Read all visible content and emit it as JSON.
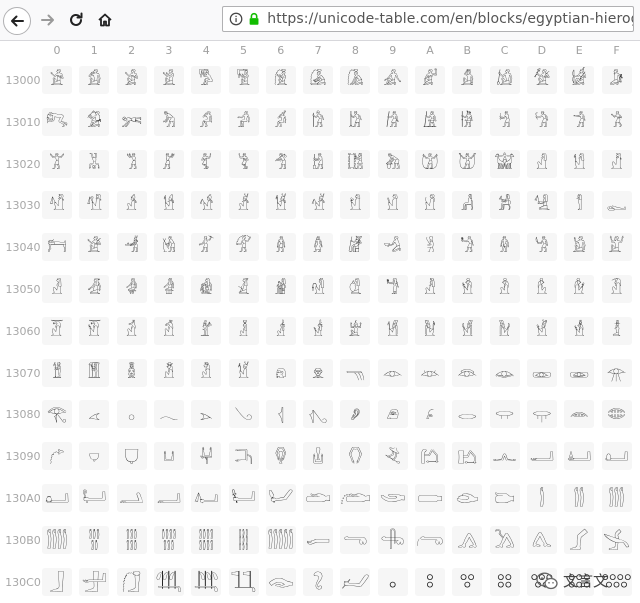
{
  "browser": {
    "url": "https://unicode-table.com/en/blocks/egyptian-hieroglyphs/",
    "icons": {
      "back": "arrow-left-icon",
      "forward": "arrow-right-icon",
      "reload": "reload-icon",
      "home": "home-icon",
      "info": "info-icon",
      "lock": "lock-icon"
    }
  },
  "table": {
    "columns": [
      "0",
      "1",
      "2",
      "3",
      "4",
      "5",
      "6",
      "7",
      "8",
      "9",
      "A",
      "B",
      "C",
      "D",
      "E",
      "F"
    ],
    "rows": [
      {
        "label": "13000",
        "chars": [
          "𓀀",
          "𓀁",
          "𓀂",
          "𓀃",
          "𓀄",
          "𓀅",
          "𓀆",
          "𓀇",
          "𓀈",
          "𓀉",
          "𓀊",
          "𓀋",
          "𓀌",
          "𓀍",
          "𓀎",
          "𓀏"
        ]
      },
      {
        "label": "13010",
        "chars": [
          "𓀐",
          "𓀑",
          "𓀒",
          "𓀓",
          "𓀔",
          "𓀕",
          "𓀖",
          "𓀗",
          "𓀘",
          "𓀙",
          "𓀚",
          "𓀛",
          "𓀜",
          "𓀝",
          "𓀞",
          "𓀟"
        ]
      },
      {
        "label": "13020",
        "chars": [
          "𓀠",
          "𓀡",
          "𓀢",
          "𓀣",
          "𓀤",
          "𓀥",
          "𓀦",
          "𓀧",
          "𓀨",
          "𓀩",
          "𓀪",
          "𓀫",
          "𓀬",
          "𓀭",
          "𓀮",
          "𓀯"
        ]
      },
      {
        "label": "13030",
        "chars": [
          "𓀰",
          "𓀱",
          "𓀲",
          "𓀳",
          "𓀴",
          "𓀵",
          "𓀶",
          "𓀷",
          "𓀸",
          "𓀹",
          "𓀺",
          "𓀻",
          "𓀼",
          "𓀽",
          "𓀾",
          "𓀿"
        ]
      },
      {
        "label": "13040",
        "chars": [
          "𓁀",
          "𓁁",
          "𓁂",
          "𓁃",
          "𓁄",
          "𓁅",
          "𓁆",
          "𓁇",
          "𓁈",
          "𓁉",
          "𓁊",
          "𓁋",
          "𓁌",
          "𓁍",
          "𓁎",
          "𓁏"
        ]
      },
      {
        "label": "13050",
        "chars": [
          "𓁐",
          "𓁑",
          "𓁒",
          "𓁓",
          "𓁔",
          "𓁕",
          "𓁖",
          "𓁗",
          "𓁘",
          "𓁙",
          "𓁚",
          "𓁛",
          "𓁜",
          "𓁝",
          "𓁞",
          "𓁟"
        ]
      },
      {
        "label": "13060",
        "chars": [
          "𓁠",
          "𓁡",
          "𓁢",
          "𓁣",
          "𓁤",
          "𓁥",
          "𓁦",
          "𓁧",
          "𓁨",
          "𓁩",
          "𓁪",
          "𓁫",
          "𓁬",
          "𓁭",
          "𓁮",
          "𓁯"
        ]
      },
      {
        "label": "13070",
        "chars": [
          "𓁰",
          "𓁱",
          "𓁲",
          "𓁳",
          "𓁴",
          "𓁵",
          "𓁶",
          "𓁷",
          "𓁸",
          "𓁹",
          "𓁺",
          "𓁻",
          "𓁼",
          "𓁽",
          "𓁾",
          "𓁿"
        ]
      },
      {
        "label": "13080",
        "chars": [
          "𓂀",
          "𓂁",
          "𓂂",
          "𓂃",
          "𓂄",
          "𓂅",
          "𓂆",
          "𓂇",
          "𓂈",
          "𓂉",
          "𓂊",
          "𓂋",
          "𓂌",
          "𓂍",
          "𓂎",
          "𓂏"
        ]
      },
      {
        "label": "13090",
        "chars": [
          "𓂐",
          "𓂑",
          "𓂒",
          "𓂓",
          "𓂔",
          "𓂕",
          "𓂖",
          "𓂗",
          "𓂘",
          "𓂙",
          "𓂚",
          "𓂛",
          "𓂜",
          "𓂝",
          "𓂞",
          "𓂟"
        ]
      },
      {
        "label": "130A0",
        "chars": [
          "𓂠",
          "𓂡",
          "𓂢",
          "𓂣",
          "𓂤",
          "𓂥",
          "𓂦",
          "𓂧",
          "𓂨",
          "𓂩",
          "𓂪",
          "𓂫",
          "𓂬",
          "𓂭",
          "𓂮",
          "𓂯"
        ]
      },
      {
        "label": "130B0",
        "chars": [
          "𓂰",
          "𓂱",
          "𓂲",
          "𓂳",
          "𓂴",
          "𓂵",
          "𓂶",
          "𓂷",
          "𓂸",
          "𓂹",
          "𓂺",
          "𓂻",
          "𓂼",
          "𓂽",
          "𓂾",
          "𓂿"
        ]
      },
      {
        "label": "130C0",
        "chars": [
          "𓃀",
          "𓃁",
          "𓃂",
          "𓃃",
          "𓃄",
          "𓃅",
          "𓃆",
          "𓃇",
          "𓃈",
          "𓃉",
          "𓃊",
          "𓃋",
          "𓃌",
          "𓃍",
          "𓃎",
          "𓃏"
        ]
      }
    ]
  },
  "watermark": {
    "text": "文言文",
    "icon": "wechat-icon"
  }
}
